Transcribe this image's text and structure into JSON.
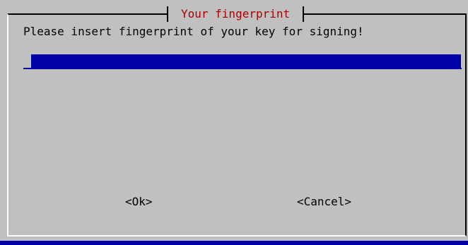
{
  "dialog": {
    "title": "Your fingerprint",
    "prompt": "Please insert fingerprint of your key for signing!",
    "input": {
      "value": ""
    },
    "buttons": {
      "ok_label": "<Ok>",
      "cancel_label": "<Cancel>"
    }
  },
  "colors": {
    "background": "#0000a8",
    "dialog": "#c0c0c0",
    "title_text": "#a80000",
    "input_field": "#0000a8"
  }
}
